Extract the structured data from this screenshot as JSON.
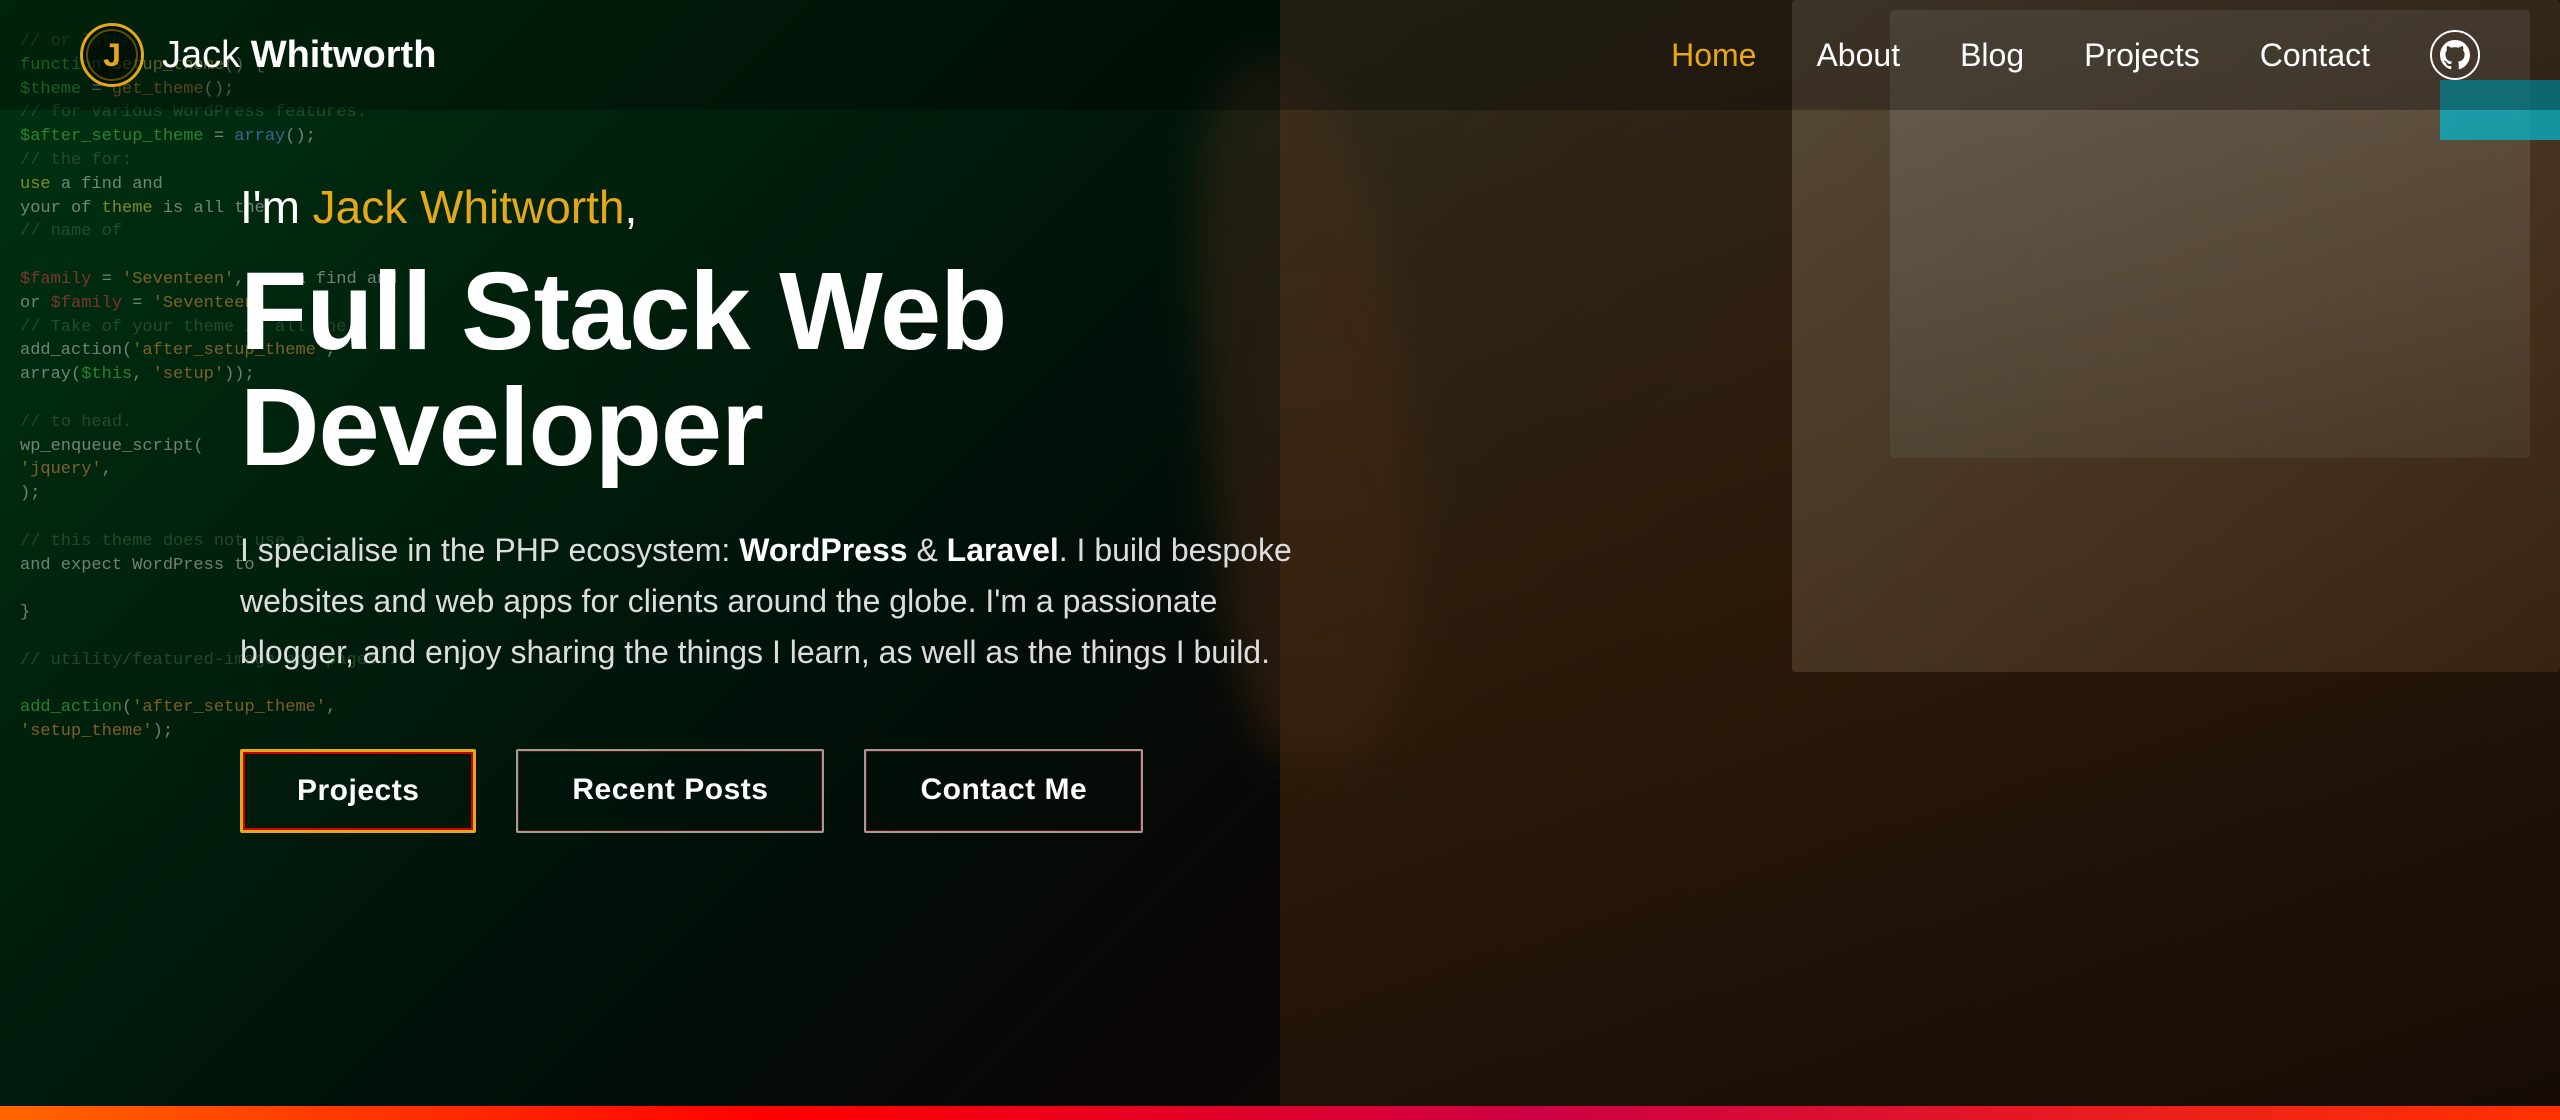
{
  "brand": {
    "logo_letter": "J",
    "name_first": "Jack ",
    "name_last": "Whitworth"
  },
  "nav": {
    "links": [
      {
        "label": "Home",
        "active": true
      },
      {
        "label": "About",
        "active": false
      },
      {
        "label": "Blog",
        "active": false
      },
      {
        "label": "Projects",
        "active": false
      },
      {
        "label": "Contact",
        "active": false
      }
    ],
    "github_label": "GitHub"
  },
  "hero": {
    "intro": "I'm ",
    "name": "Jack Whitworth",
    "comma": ",",
    "title": "Full Stack Web Developer",
    "description_plain": "I specialise in the PHP ecosystem: ",
    "description_wp": "WordPress",
    "description_amp": " & ",
    "description_laravel": "Laravel",
    "description_end": ". I build bespoke websites and web apps for clients around the globe. I'm a passionate blogger, and enjoy sharing the things I learn, as well as the things I build.",
    "buttons": [
      {
        "label": "Projects",
        "style": "primary"
      },
      {
        "label": "Recent Posts",
        "style": "secondary"
      },
      {
        "label": "Contact Me",
        "style": "secondary"
      }
    ]
  },
  "colors": {
    "accent": "#e6a817",
    "accent_red": "#cc0000",
    "nav_active": "#e6a817",
    "bottom_bar_start": "#ff6600",
    "bottom_bar_end": "#ff3300"
  }
}
